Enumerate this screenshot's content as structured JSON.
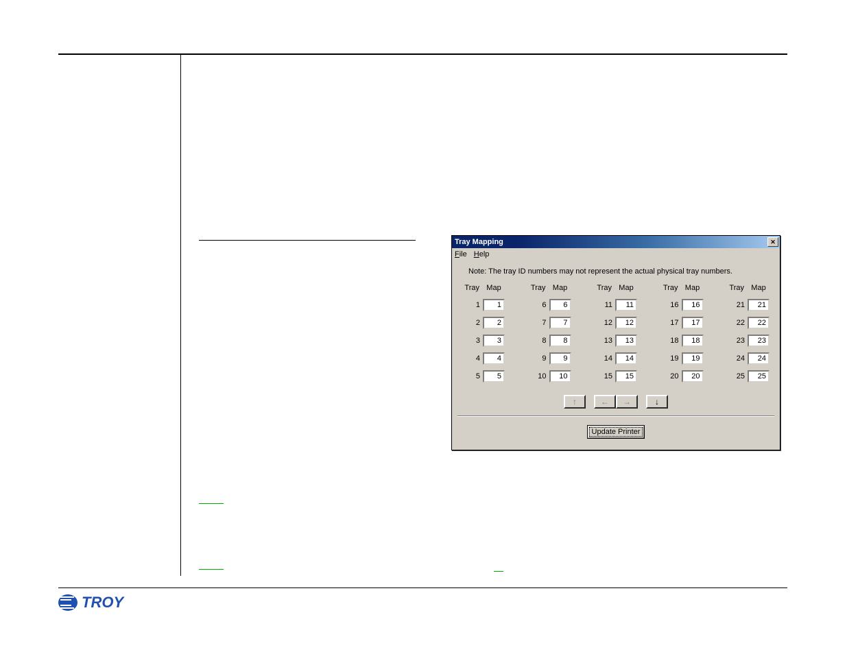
{
  "dialog": {
    "title": "Tray Mapping",
    "close_glyph": "✕",
    "menu": {
      "file": "File",
      "help": "Help"
    },
    "note": "Note: The tray ID numbers may not represent the actual physical tray numbers.",
    "col_head_tray": "Tray",
    "col_head_map": "Map",
    "columns": [
      {
        "rows": [
          {
            "tray": "1",
            "map": "1"
          },
          {
            "tray": "2",
            "map": "2"
          },
          {
            "tray": "3",
            "map": "3"
          },
          {
            "tray": "4",
            "map": "4"
          },
          {
            "tray": "5",
            "map": "5"
          }
        ]
      },
      {
        "rows": [
          {
            "tray": "6",
            "map": "6"
          },
          {
            "tray": "7",
            "map": "7"
          },
          {
            "tray": "8",
            "map": "8"
          },
          {
            "tray": "9",
            "map": "9"
          },
          {
            "tray": "10",
            "map": "10"
          }
        ]
      },
      {
        "rows": [
          {
            "tray": "11",
            "map": "11"
          },
          {
            "tray": "12",
            "map": "12"
          },
          {
            "tray": "13",
            "map": "13"
          },
          {
            "tray": "14",
            "map": "14"
          },
          {
            "tray": "15",
            "map": "15"
          }
        ]
      },
      {
        "rows": [
          {
            "tray": "16",
            "map": "16"
          },
          {
            "tray": "17",
            "map": "17"
          },
          {
            "tray": "18",
            "map": "18"
          },
          {
            "tray": "19",
            "map": "19"
          },
          {
            "tray": "20",
            "map": "20"
          }
        ]
      },
      {
        "rows": [
          {
            "tray": "21",
            "map": "21"
          },
          {
            "tray": "22",
            "map": "22"
          },
          {
            "tray": "23",
            "map": "23"
          },
          {
            "tray": "24",
            "map": "24"
          },
          {
            "tray": "25",
            "map": "25"
          }
        ]
      }
    ],
    "nav": {
      "up": "↑",
      "left": "←",
      "right": "→",
      "down": "↓"
    },
    "update_label": "Update Printer"
  },
  "logo": {
    "text": "TROY"
  }
}
